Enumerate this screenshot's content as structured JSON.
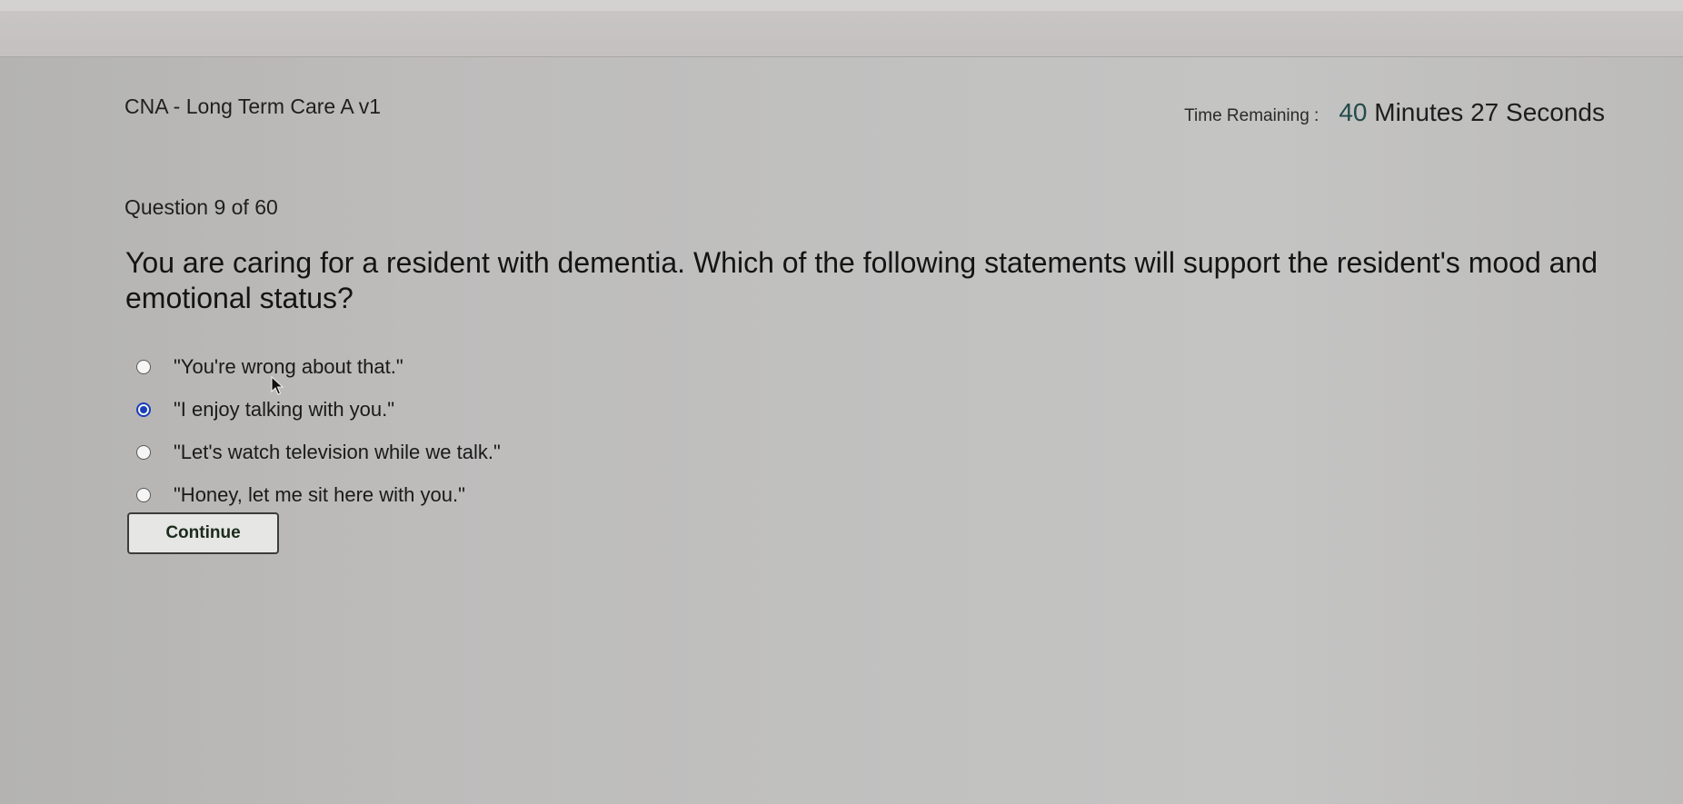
{
  "header": {
    "app_title": "CNA - Long Term Care A v1",
    "timer_label": "Time Remaining :",
    "timer": {
      "minutes": "40",
      "minutes_unit": "Minutes",
      "seconds": "27",
      "seconds_unit": "Seconds"
    }
  },
  "quiz": {
    "counter": "Question 9 of 60",
    "question": "You are caring for a resident with dementia. Which of the following statements will support the resident's mood and emotional status?",
    "options": [
      {
        "label": "\"You're wrong about that.\"",
        "selected": false
      },
      {
        "label": "\"I enjoy talking with you.\"",
        "selected": true
      },
      {
        "label": "\"Let's watch television while we talk.\"",
        "selected": false
      },
      {
        "label": "\"Honey, let me sit here with you.\"",
        "selected": false
      }
    ],
    "continue_label": "Continue"
  },
  "colors": {
    "radio_selected": "#1a3fb8",
    "timer_number": "#234a4a"
  },
  "icons": {
    "pointer": "mouse-pointer-icon"
  }
}
